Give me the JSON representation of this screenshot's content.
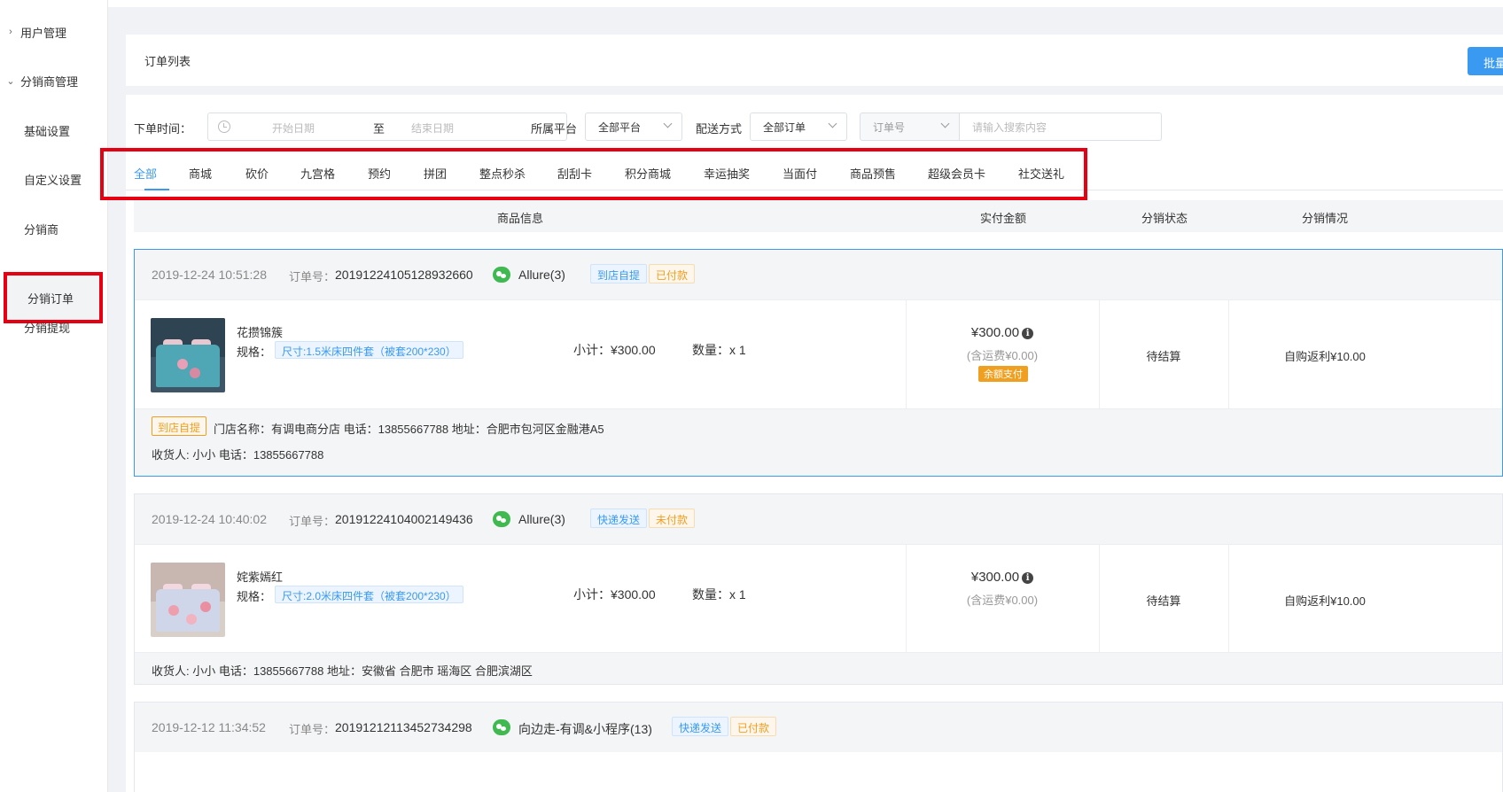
{
  "sidebar": {
    "groups": [
      {
        "label": "用户管理",
        "chevron": "chevron-right-icon"
      },
      {
        "label": "分销商管理",
        "chevron": "chevron-down-icon"
      }
    ],
    "items": [
      {
        "label": "基础设置"
      },
      {
        "label": "自定义设置"
      },
      {
        "label": "分销商"
      },
      {
        "label": "分销订单"
      },
      {
        "label": "分销提现"
      }
    ]
  },
  "header": {
    "title": "订单列表",
    "batch_button": "批量"
  },
  "filters": {
    "order_time_label": "下单时间：",
    "start_placeholder": "开始日期",
    "separator": "至",
    "end_placeholder": "结束日期",
    "platform_label": "所属平台",
    "platform_value": "全部平台",
    "delivery_label": "配送方式",
    "delivery_value": "全部订单",
    "search_field": "订单号",
    "search_placeholder": "请输入搜索内容"
  },
  "tabs": [
    "全部",
    "商城",
    "砍价",
    "九宫格",
    "预约",
    "拼团",
    "整点秒杀",
    "刮刮卡",
    "积分商城",
    "幸运抽奖",
    "当面付",
    "商品预售",
    "超级会员卡",
    "社交送礼"
  ],
  "columns": [
    "商品信息",
    "实付金额",
    "分销状态",
    "分销情况"
  ],
  "orders": [
    {
      "time": "2019-12-24 10:51:28",
      "order_no_label": "订单号：",
      "order_no": "20191224105128932660",
      "user": "Allure(3)",
      "delivery_tag": "到店自提",
      "pay_tag": "已付款",
      "product_name": "花攒锦簇",
      "spec_label": "规格：",
      "spec": "尺寸:1.5米床四件套（被套200*230）",
      "subtotal": "小计：¥300.00",
      "quantity": "数量：x 1",
      "amount": "¥300.00",
      "amount_sub": "(含运费¥0.00)",
      "pay_method": "余额支付",
      "status": "待结算",
      "rebate": "自购返利¥10.00",
      "foot_tag": "到店自提",
      "foot_line1": "门店名称：有调电商分店 电话：13855667788 地址：合肥市包河区金融港A5",
      "foot_line2": "收货人: 小小 电话：13855667788"
    },
    {
      "time": "2019-12-24 10:40:02",
      "order_no_label": "订单号：",
      "order_no": "20191224104002149436",
      "user": "Allure(3)",
      "delivery_tag": "快递发送",
      "pay_tag": "未付款",
      "product_name": "姹紫嫣红",
      "spec_label": "规格：",
      "spec": "尺寸:2.0米床四件套（被套200*230）",
      "subtotal": "小计：¥300.00",
      "quantity": "数量：x 1",
      "amount": "¥300.00",
      "amount_sub": "(含运费¥0.00)",
      "status": "待结算",
      "rebate": "自购返利¥10.00",
      "foot_line1": "收货人: 小小 电话：13855667788 地址：安徽省 合肥市 瑶海区 合肥滨湖区"
    },
    {
      "time": "2019-12-12 11:34:52",
      "order_no_label": "订单号：",
      "order_no": "20191212113452734298",
      "user": "向边走-有调&小程序(13)",
      "delivery_tag": "快递发送",
      "pay_tag": "已付款"
    }
  ],
  "colors": {
    "accent": "#3a99f0",
    "highlight": "#e60012",
    "orange": "#f0a020",
    "wechat": "#3fb950"
  }
}
